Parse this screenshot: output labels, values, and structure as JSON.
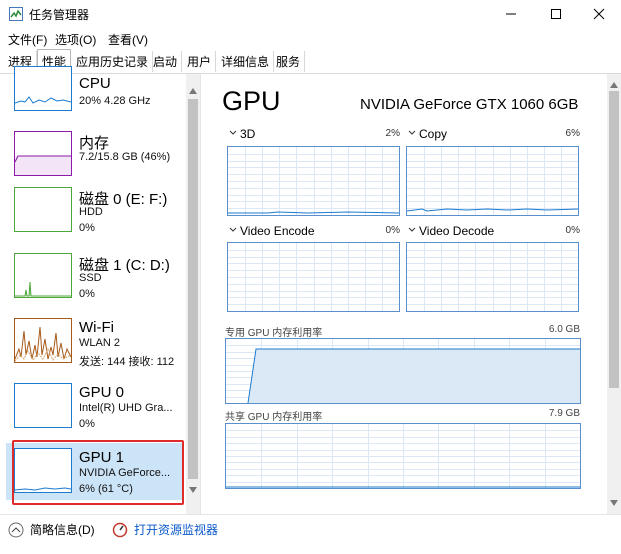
{
  "window": {
    "title": "任务管理器"
  },
  "menu": [
    "文件(F)",
    "选项(O)",
    "查看(V)"
  ],
  "tabs": [
    "进程",
    "性能",
    "应用历史记录",
    "启动",
    "用户",
    "详细信息",
    "服务"
  ],
  "active_tab": "性能",
  "sidebar": [
    {
      "name": "CPU",
      "line1": "20%  4.28 GHz",
      "line2": "",
      "color": "#1a7bcf"
    },
    {
      "name": "内存",
      "line1": "7.2/15.8 GB (46%)",
      "line2": "",
      "color": "#8b1aa8"
    },
    {
      "name": "磁盘 0 (E: F:)",
      "line1": "HDD",
      "line2": "0%",
      "color": "#4ca63a"
    },
    {
      "name": "磁盘 1 (C: D:)",
      "line1": "SSD",
      "line2": "0%",
      "color": "#4ca63a"
    },
    {
      "name": "Wi-Fi",
      "line1": "WLAN 2",
      "line2": "发送: 144 接收: 112",
      "color": "#a65a1a"
    },
    {
      "name": "GPU 0",
      "line1": "Intel(R) UHD Gra...",
      "line2": "0%",
      "color": "#1a7bcf"
    },
    {
      "name": "GPU 1",
      "line1": "NVIDIA GeForce...",
      "line2": "6% (61 °C)",
      "color": "#1a7bcf"
    }
  ],
  "detail": {
    "title": "GPU",
    "model": "NVIDIA GeForce GTX 1060 6GB",
    "engines": [
      {
        "label": "3D",
        "pct": "2%"
      },
      {
        "label": "Copy",
        "pct": "6%"
      },
      {
        "label": "Video Encode",
        "pct": "0%"
      },
      {
        "label": "Video Decode",
        "pct": "0%"
      }
    ],
    "dedicated": {
      "label": "专用 GPU 内存利用率",
      "max": "6.0 GB"
    },
    "shared": {
      "label": "共享 GPU 内存利用率",
      "max": "7.9 GB"
    },
    "colors": {
      "accent": "#1a7bcf",
      "grid": "#dce8f5",
      "border": "#5a8fce"
    }
  },
  "footer": {
    "fewer": "简略信息(D)",
    "monitor": "打开资源监视器"
  }
}
